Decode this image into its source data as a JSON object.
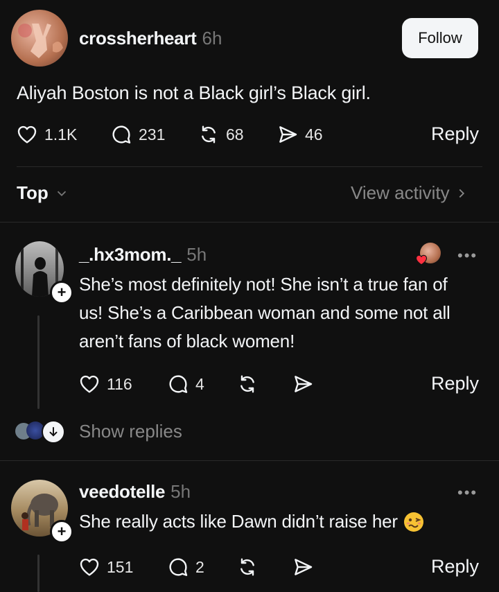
{
  "post": {
    "username": "crossherheart",
    "time": "6h",
    "follow_label": "Follow",
    "text": "Aliyah Boston is not a Black girl’s Black girl.",
    "likes": "1.1K",
    "comments": "231",
    "reposts": "68",
    "shares": "46",
    "reply_label": "Reply"
  },
  "sort_bar": {
    "sort_label": "Top",
    "activity_label": "View activity"
  },
  "replies": [
    {
      "username": "_.hx3mom._",
      "time": "5h",
      "text_lines": [
        "She’s most definitely not! She isn’t a true fan of",
        "us! She’s a Caribbean woman and some not all",
        "aren’t fans of black women!"
      ],
      "likes": "116",
      "comments": "4",
      "reply_label": "Reply",
      "show_replies_label": "Show replies"
    },
    {
      "username": "veedotelle",
      "time": "5h",
      "text": "She really acts like Dawn didn’t raise her",
      "emoji": "🥴",
      "likes": "151",
      "comments": "2",
      "reply_label": "Reply"
    }
  ],
  "colors": {
    "background": "#101010",
    "text": "#f3f5f7",
    "muted": "#777777",
    "divider": "#2a2a2a",
    "like_heart": "#ff3040"
  },
  "icons": [
    "heart-icon",
    "comment-icon",
    "repost-icon",
    "share-icon",
    "chevron-down-icon",
    "chevron-right-icon",
    "more-icon",
    "plus-icon",
    "arrow-down-icon"
  ]
}
